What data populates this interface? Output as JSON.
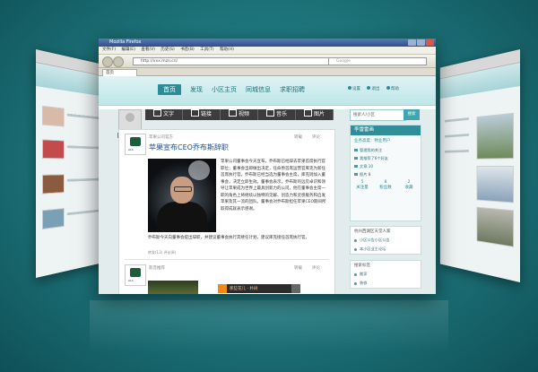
{
  "browser": {
    "title": "Mozilla Firefox",
    "menu": [
      "文件(F)",
      "编辑(E)",
      "查看(V)",
      "历史(S)",
      "书签(B)",
      "工具(T)",
      "帮助(H)"
    ],
    "url": "http://xxx.mzn.cn/",
    "search_placeholder": "Google",
    "tab_label": "首页"
  },
  "site": {
    "nav": [
      "首页",
      "发现",
      "小区主页",
      "同城信息",
      "求职招聘"
    ],
    "header_links": [
      "设置",
      "退出",
      "帮助"
    ]
  },
  "composer": {
    "avatar_label": "上传头像",
    "tabs": [
      "文字",
      "链接",
      "视频",
      "音乐",
      "图片"
    ]
  },
  "feed": {
    "posts": [
      {
        "source": "苹果公司官方",
        "actions": [
          "转载",
          "评论"
        ],
        "headline": "苹果宣布CEO乔布斯辞职",
        "body": "苹果公司董事会今天宣布，乔布斯已经辞去苹果首席执行官职位；董事会当即做出决定，任命原首席运营官库克为新任首席执行官。乔布斯已经当选为董事会主席，库克则加入董事会，决定立即生效。董事会表示，乔布斯的远见卓识和领导让苹果成为世界上最具创新力的公司，他在董事会主席一职的角色上将继续以独特的见解、创造力和灵感服务和启发苹果及其一流的团队。董事会对乔布斯担任苹果CEO期间所取得成就表示感谢。",
        "body2": "乔布斯今天向董事会提出辞职，并建议董事会执行其继任计划，建议库克接任首席执行官。",
        "more": "转发(13) 评论(8)"
      },
      {
        "source": "影音推荐",
        "actions": [
          "转载",
          "评论"
        ],
        "track": "那些花儿 - 朴树"
      }
    ]
  },
  "sidebar": {
    "search_placeholder": "搜索人/小区",
    "search_button": "搜索",
    "panel_title": "李雷雷画",
    "panel_sub": "业务高度：物业用户",
    "items": [
      "管理我的关注",
      "我推荐了6个好友",
      "文章 10",
      "图片 8"
    ],
    "stats": [
      {
        "n": "5",
        "l": "关注量"
      },
      {
        "n": "8",
        "l": "粉丝数"
      },
      {
        "n": "2",
        "l": "收藏"
      }
    ],
    "group_title": "杭州西湖区天堂人家",
    "group_items": [
      "小区公告小区公告",
      "本小区业主论坛"
    ],
    "bottom_title": "搜索标签",
    "bottom_items": [
      "搬家",
      "装修"
    ]
  },
  "colors": {
    "background": "#1f7a80",
    "accent": "#2b8d97"
  }
}
